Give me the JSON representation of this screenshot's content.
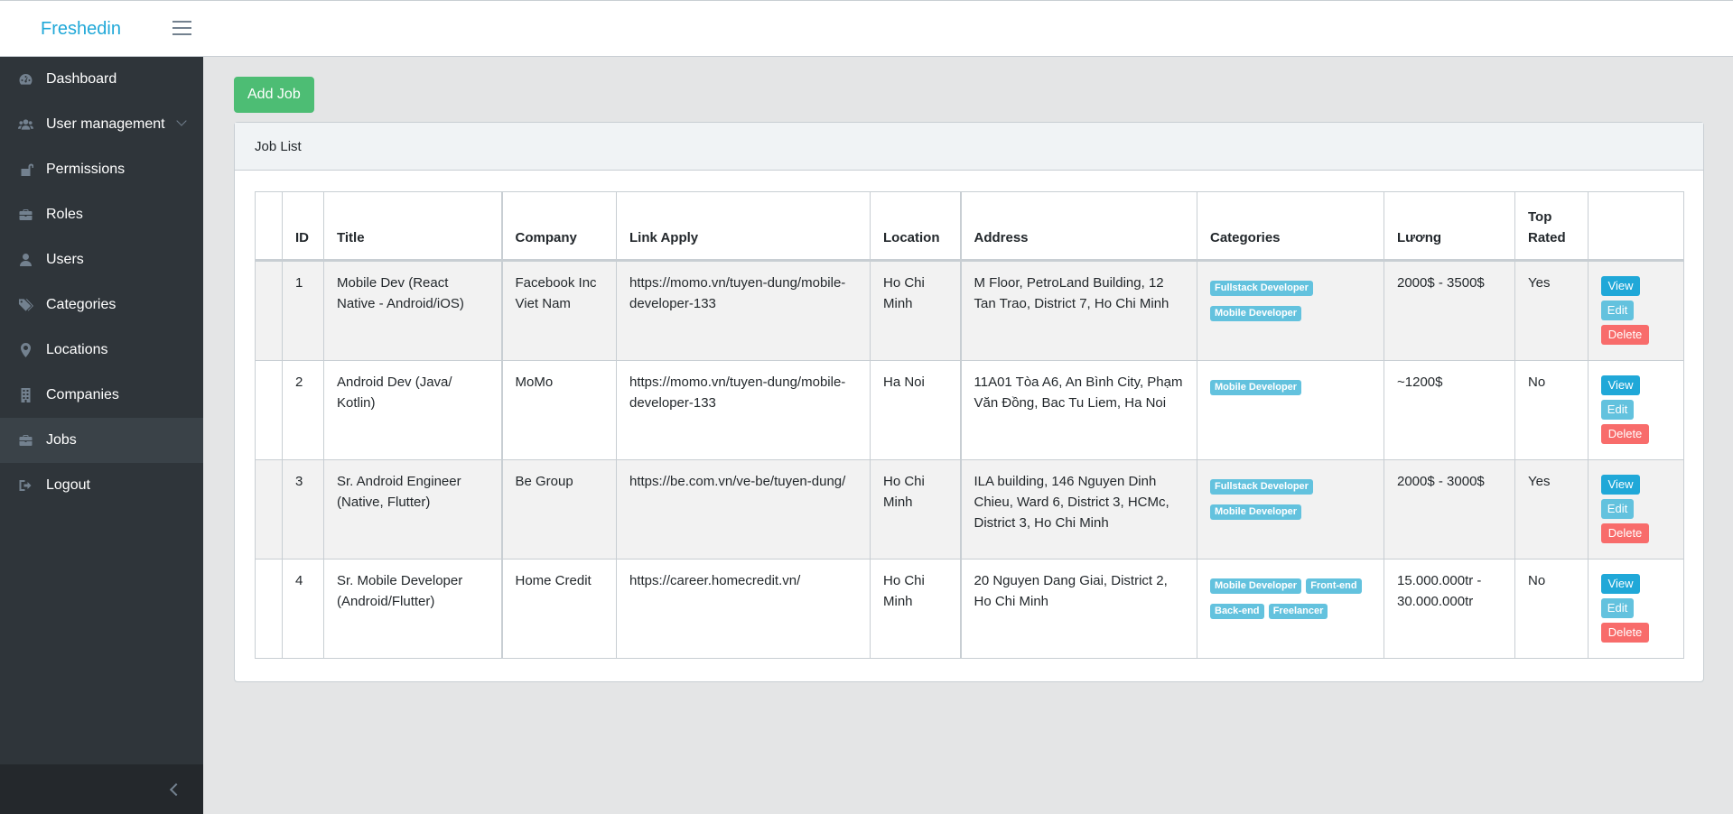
{
  "app": {
    "brand": "Freshedin"
  },
  "sidebar": {
    "items": [
      {
        "label": "Dashboard",
        "icon": "dashboard-icon"
      },
      {
        "label": "User management",
        "icon": "users-icon"
      },
      {
        "label": "Permissions",
        "icon": "unlock-icon"
      },
      {
        "label": "Roles",
        "icon": "briefcase-icon"
      },
      {
        "label": "Users",
        "icon": "user-icon"
      },
      {
        "label": "Categories",
        "icon": "tags-icon"
      },
      {
        "label": "Locations",
        "icon": "map-marker-icon"
      },
      {
        "label": "Companies",
        "icon": "building-icon"
      },
      {
        "label": "Jobs",
        "icon": "briefcase-icon"
      },
      {
        "label": "Logout",
        "icon": "sign-out-icon"
      }
    ],
    "active": "Jobs"
  },
  "toolbar": {
    "add_job_label": "Add Job"
  },
  "card": {
    "title": "Job List"
  },
  "table": {
    "headers": {
      "id": "ID",
      "title": "Title",
      "company": "Company",
      "link": "Link Apply",
      "location": "Location",
      "address": "Address",
      "categories": "Categories",
      "salary": "Lương",
      "top_rated": "Top Rated"
    },
    "actions": {
      "view": "View",
      "edit": "Edit",
      "delete": "Delete"
    },
    "rows": [
      {
        "id": "1",
        "title": "Mobile Dev (React Native - Android/iOS)",
        "company": "Facebook Inc Viet Nam",
        "link": "https://momo.vn/tuyen-dung/mobile-developer-133",
        "location": "Ho Chi Minh",
        "address": "M Floor, PetroLand Building, 12 Tan Trao, District 7, Ho Chi Minh",
        "categories": [
          "Fullstack Developer",
          "Mobile Developer"
        ],
        "salary": "2000$ - 3500$",
        "top_rated": "Yes"
      },
      {
        "id": "2",
        "title": "Android Dev (Java/ Kotlin)",
        "company": "MoMo",
        "link": "https://momo.vn/tuyen-dung/mobile-developer-133",
        "location": "Ha Noi",
        "address": "11A01 Tòa A6, An Bình City, Phạm Văn Đồng, Bac Tu Liem, Ha Noi",
        "categories": [
          "Mobile Developer"
        ],
        "salary": "~1200$",
        "top_rated": "No"
      },
      {
        "id": "3",
        "title": "Sr. Android Engineer (Native, Flutter)",
        "company": "Be Group",
        "link": "https://be.com.vn/ve-be/tuyen-dung/",
        "location": "Ho Chi Minh",
        "address": "ILA building, 146 Nguyen Dinh Chieu, Ward 6, District 3, HCMc, District 3, Ho Chi Minh",
        "categories": [
          "Fullstack Developer",
          "Mobile Developer"
        ],
        "salary": "2000$ - 3000$",
        "top_rated": "Yes"
      },
      {
        "id": "4",
        "title": "Sr. Mobile Developer (Android/Flutter)",
        "company": "Home Credit",
        "link": "https://career.homecredit.vn/",
        "location": "Ho Chi Minh",
        "address": "20 Nguyen Dang Giai, District 2, Ho Chi Minh",
        "categories": [
          "Mobile Developer",
          "Front-end",
          "Back-end",
          "Freelancer"
        ],
        "salary": "15.000.000tr - 30.000.000tr",
        "top_rated": "No"
      }
    ]
  }
}
